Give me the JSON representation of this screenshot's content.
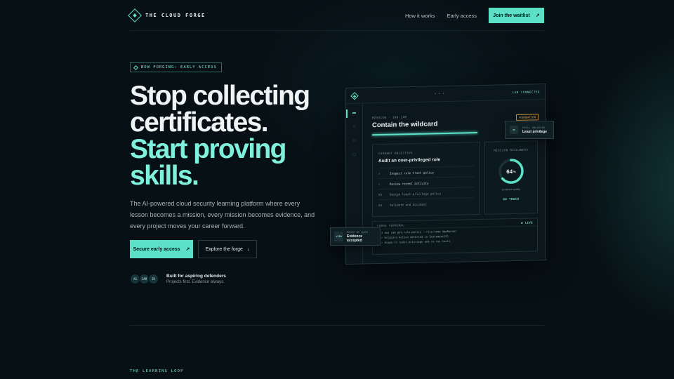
{
  "nav": {
    "brand": "THE CLOUD FORGE",
    "links": [
      "How it works",
      "Early access"
    ],
    "cta": "Join the waitlist",
    "cta_arrow": "↗"
  },
  "hero": {
    "badge": "NOW FORGING: EARLY ACCESS",
    "headline_line1": "Stop collecting",
    "headline_line2": "certificates.",
    "headline_line3": "Start proving",
    "headline_line4": "skills.",
    "subcopy": "The AI-powered cloud security learning platform where every lesson becomes a mission, every mission becomes evidence, and every project moves your career forward.",
    "primary_cta": "Secure early access",
    "primary_arrow": "↗",
    "secondary_cta": "Explore the forge",
    "secondary_arrow": "↓",
    "avatars": [
      "AS",
      "IAM",
      "IR"
    ],
    "social_title": "Built for aspiring defenders",
    "social_sub": "Projects first. Evidence always."
  },
  "mock": {
    "dots": "• • •",
    "status": "LAB CONNECTED",
    "rail": [
      "▬",
      "◇",
      "⬡",
      "▢",
      "⚙"
    ],
    "mission_kicker": "MISSION · 108-IAM",
    "mission_title": "Contain the wildcard",
    "tag": "FOUNDATION",
    "objective_kicker": "CURRENT OBJECTIVE",
    "objective_title": "Audit an over-privileged role",
    "tasks": [
      {
        "mark": "✓",
        "label": "Inspect role trust policy",
        "done": true
      },
      {
        "mark": "✓",
        "label": "Review recent activity",
        "done": true
      },
      {
        "mark": "03",
        "label": "Design least-privilege policy",
        "done": false
      },
      {
        "mark": "04",
        "label": "Validate and document",
        "done": false
      }
    ],
    "readiness_kicker": "MISSION READINESS",
    "readiness_value": "64",
    "readiness_unit": "%",
    "readiness_fraction": 0.64,
    "readiness_caption": "Evidence quality",
    "readiness_status": "ON TRACK",
    "terminal_title": "FORGE TERMINAL",
    "terminal_live": "● LIVE",
    "terminal_lines": [
      "$ aws iam get-role-policy --role-name AppRunner",
      "> Wildcard Action detected in Statement[0]",
      "> Scope to least privilege and re-run tests_"
    ],
    "pop_right_kicker": "SKILL UNLOCKED",
    "pop_right_value": "Least privilege",
    "pop_right_icon": "⚿",
    "pop_left_xp": "+120",
    "pop_left_kicker": "PROOF OF WORK",
    "pop_left_value": "Evidence accepted"
  },
  "section_label": "THE LEARNING LOOP",
  "colors": {
    "accent": "#5de0c8",
    "accent_text": "#7ff0dc",
    "background": "#071015",
    "warning": "#e0a85a"
  }
}
